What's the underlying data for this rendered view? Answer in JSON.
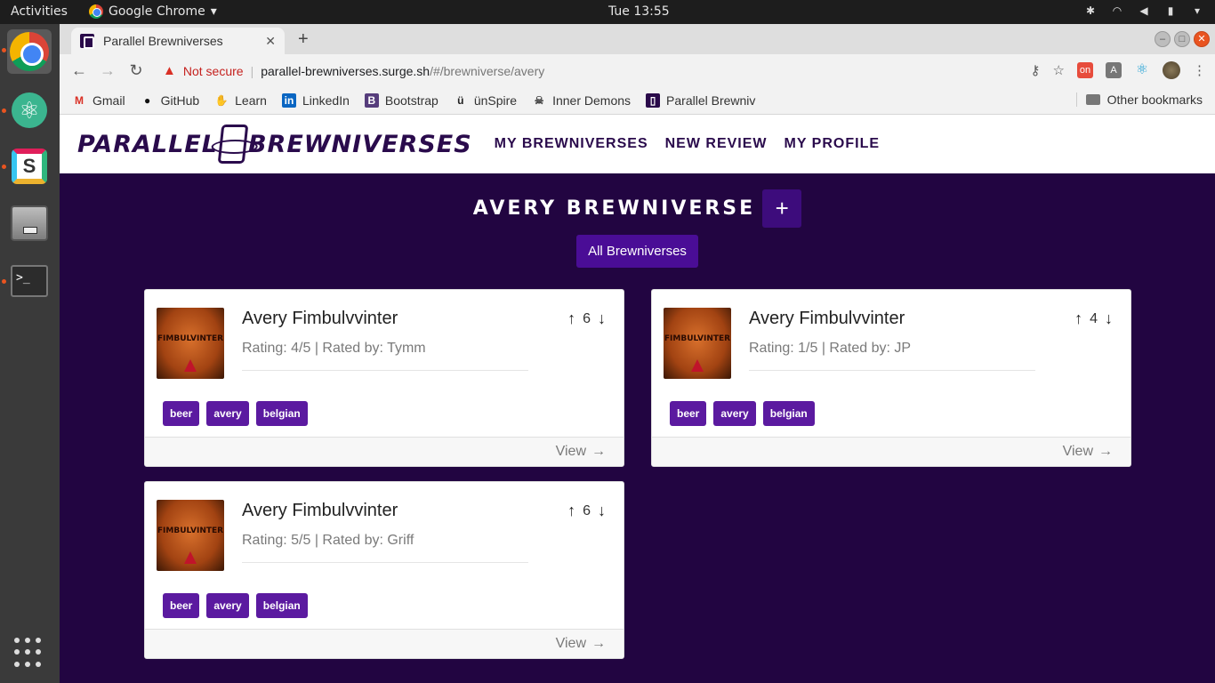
{
  "os": {
    "activities": "Activities",
    "app_menu": "Google Chrome",
    "clock": "Tue 13:55"
  },
  "browser": {
    "tab_title": "Parallel Brewniverses",
    "security_label": "Not secure",
    "url_host": "parallel-brewniverses.surge.sh",
    "url_path": "/#/brewniverse/avery",
    "bookmarks": [
      {
        "label": "Gmail",
        "icon": "gmail-icon"
      },
      {
        "label": "GitHub",
        "icon": "github-icon"
      },
      {
        "label": "Learn",
        "icon": "learn-icon"
      },
      {
        "label": "LinkedIn",
        "icon": "linkedin-icon"
      },
      {
        "label": "Bootstrap",
        "icon": "bootstrap-icon"
      },
      {
        "label": "ünSpire",
        "icon": "unspire-icon"
      },
      {
        "label": "Inner Demons",
        "icon": "skull-icon"
      },
      {
        "label": "Parallel Brewniv",
        "icon": "brewniverse-icon"
      }
    ],
    "other_bookmarks": "Other bookmarks",
    "ext_on_label": "on",
    "ext_a_label": "A"
  },
  "app": {
    "brand_left": "PARALLEL",
    "brand_right": "BREWNIVERSES",
    "nav": [
      "MY BREWNIVERSES",
      "NEW REVIEW",
      "MY PROFILE"
    ],
    "heading": "AVERY BREWNIVERSE",
    "add_label": "+",
    "all_button": "All Brewniverses",
    "view_label": "View",
    "label_art": "FIMBULVINTER",
    "cards": [
      {
        "name": "Avery Fimbulvvinter",
        "meta": "Rating: 4/5 | Rated by: Tymm",
        "votes": "6",
        "tags": [
          "beer",
          "avery",
          "belgian"
        ]
      },
      {
        "name": "Avery Fimbulvvinter",
        "meta": "Rating: 1/5 | Rated by: JP",
        "votes": "4",
        "tags": [
          "beer",
          "avery",
          "belgian"
        ]
      },
      {
        "name": "Avery Fimbulvvinter",
        "meta": "Rating: 5/5 | Rated by: Griff",
        "votes": "6",
        "tags": [
          "beer",
          "avery",
          "belgian"
        ]
      }
    ]
  }
}
